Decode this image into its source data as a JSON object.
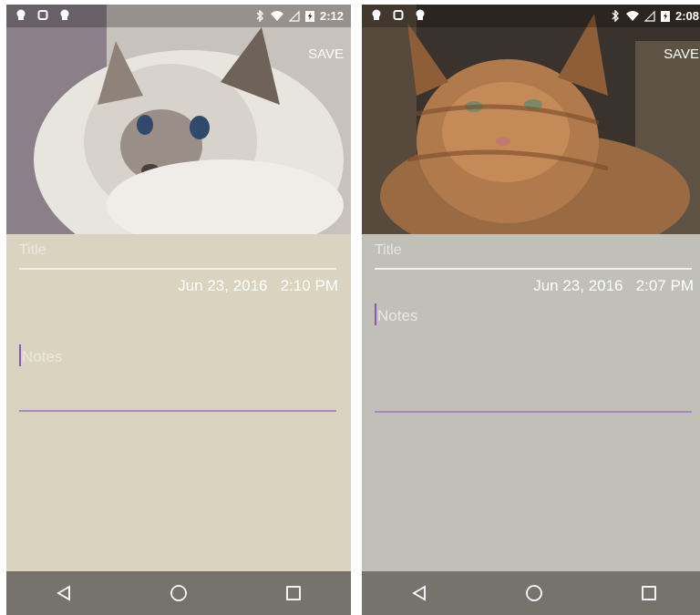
{
  "screens": [
    {
      "status": {
        "time": "2:12"
      },
      "actions": {
        "save_label": "SAVE"
      },
      "form": {
        "title_placeholder": "Title",
        "datetime": "Jun 23, 2016   2:10 PM",
        "notes_placeholder": "Notes"
      },
      "photo": {
        "subject": "white-grey-cat"
      }
    },
    {
      "status": {
        "time": "2:08"
      },
      "actions": {
        "save_label": "SAVE"
      },
      "form": {
        "title_placeholder": "Title",
        "datetime": "Jun 23, 2016   2:07 PM",
        "notes_placeholder": "Notes"
      },
      "photo": {
        "subject": "orange-tabby-cat"
      }
    }
  ],
  "colors": {
    "screen1_bg": "#d9d3bf",
    "screen2_bg": "#c0c0b8",
    "accent": "#8b58b3",
    "navbar": "#75736b"
  },
  "icons": {
    "status_left": [
      "android-icon",
      "watch-icon",
      "android-icon"
    ],
    "status_right": [
      "bluetooth-icon",
      "wifi-icon",
      "signal-icon",
      "battery-charging-icon"
    ],
    "nav": [
      "back-icon",
      "home-icon",
      "recents-icon"
    ]
  }
}
